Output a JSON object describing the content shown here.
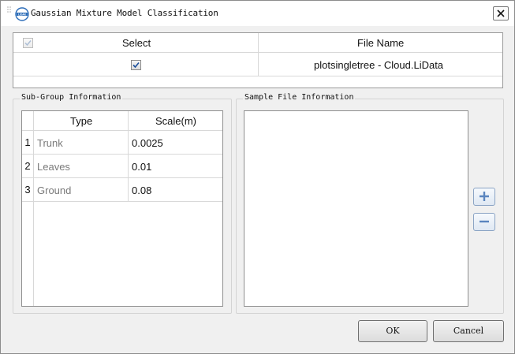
{
  "window": {
    "title": "Gaussian Mixture Model Classification",
    "app_icon": "lidar-logo-icon",
    "close_icon": "close-icon"
  },
  "file_table": {
    "headers": {
      "select": "Select",
      "file_name": "File Name"
    },
    "header_checkbox_checked": true,
    "header_checkbox_disabled": true,
    "rows": [
      {
        "checked": true,
        "file_name": "plotsingletree - Cloud.LiData"
      }
    ]
  },
  "subgroup": {
    "label": "Sub-Group Information",
    "headers": {
      "type": "Type",
      "scale": "Scale(m)"
    },
    "rows": [
      {
        "num": "1",
        "type": "Trunk",
        "scale": "0.0025"
      },
      {
        "num": "2",
        "type": "Leaves",
        "scale": "0.01"
      },
      {
        "num": "3",
        "type": "Ground",
        "scale": "0.08"
      }
    ]
  },
  "sample": {
    "label": "Sample File Information",
    "items": [],
    "add_icon": "plus-icon",
    "remove_icon": "minus-icon"
  },
  "buttons": {
    "ok": "OK",
    "cancel": "Cancel"
  },
  "colors": {
    "checkmark": "#1c4f9c",
    "side_button_icon": "#5a85bf"
  }
}
